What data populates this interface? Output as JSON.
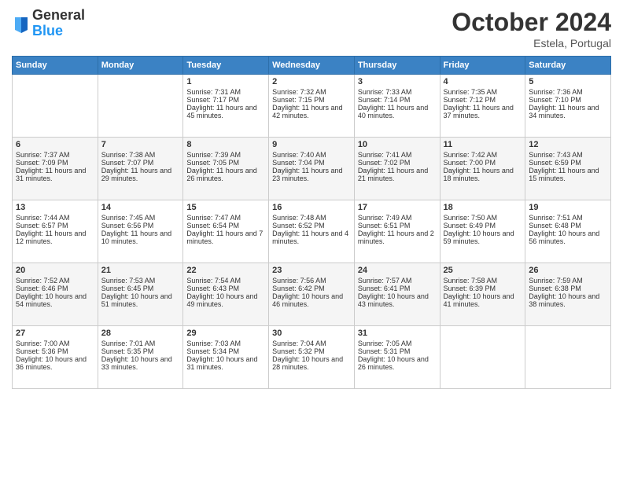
{
  "header": {
    "logo_general": "General",
    "logo_blue": "Blue",
    "month": "October 2024",
    "location": "Estela, Portugal"
  },
  "days_of_week": [
    "Sunday",
    "Monday",
    "Tuesday",
    "Wednesday",
    "Thursday",
    "Friday",
    "Saturday"
  ],
  "weeks": [
    [
      {
        "day": "",
        "content": ""
      },
      {
        "day": "",
        "content": ""
      },
      {
        "day": "1",
        "sunrise": "Sunrise: 7:31 AM",
        "sunset": "Sunset: 7:17 PM",
        "daylight": "Daylight: 11 hours and 45 minutes."
      },
      {
        "day": "2",
        "sunrise": "Sunrise: 7:32 AM",
        "sunset": "Sunset: 7:15 PM",
        "daylight": "Daylight: 11 hours and 42 minutes."
      },
      {
        "day": "3",
        "sunrise": "Sunrise: 7:33 AM",
        "sunset": "Sunset: 7:14 PM",
        "daylight": "Daylight: 11 hours and 40 minutes."
      },
      {
        "day": "4",
        "sunrise": "Sunrise: 7:35 AM",
        "sunset": "Sunset: 7:12 PM",
        "daylight": "Daylight: 11 hours and 37 minutes."
      },
      {
        "day": "5",
        "sunrise": "Sunrise: 7:36 AM",
        "sunset": "Sunset: 7:10 PM",
        "daylight": "Daylight: 11 hours and 34 minutes."
      }
    ],
    [
      {
        "day": "6",
        "sunrise": "Sunrise: 7:37 AM",
        "sunset": "Sunset: 7:09 PM",
        "daylight": "Daylight: 11 hours and 31 minutes."
      },
      {
        "day": "7",
        "sunrise": "Sunrise: 7:38 AM",
        "sunset": "Sunset: 7:07 PM",
        "daylight": "Daylight: 11 hours and 29 minutes."
      },
      {
        "day": "8",
        "sunrise": "Sunrise: 7:39 AM",
        "sunset": "Sunset: 7:05 PM",
        "daylight": "Daylight: 11 hours and 26 minutes."
      },
      {
        "day": "9",
        "sunrise": "Sunrise: 7:40 AM",
        "sunset": "Sunset: 7:04 PM",
        "daylight": "Daylight: 11 hours and 23 minutes."
      },
      {
        "day": "10",
        "sunrise": "Sunrise: 7:41 AM",
        "sunset": "Sunset: 7:02 PM",
        "daylight": "Daylight: 11 hours and 21 minutes."
      },
      {
        "day": "11",
        "sunrise": "Sunrise: 7:42 AM",
        "sunset": "Sunset: 7:00 PM",
        "daylight": "Daylight: 11 hours and 18 minutes."
      },
      {
        "day": "12",
        "sunrise": "Sunrise: 7:43 AM",
        "sunset": "Sunset: 6:59 PM",
        "daylight": "Daylight: 11 hours and 15 minutes."
      }
    ],
    [
      {
        "day": "13",
        "sunrise": "Sunrise: 7:44 AM",
        "sunset": "Sunset: 6:57 PM",
        "daylight": "Daylight: 11 hours and 12 minutes."
      },
      {
        "day": "14",
        "sunrise": "Sunrise: 7:45 AM",
        "sunset": "Sunset: 6:56 PM",
        "daylight": "Daylight: 11 hours and 10 minutes."
      },
      {
        "day": "15",
        "sunrise": "Sunrise: 7:47 AM",
        "sunset": "Sunset: 6:54 PM",
        "daylight": "Daylight: 11 hours and 7 minutes."
      },
      {
        "day": "16",
        "sunrise": "Sunrise: 7:48 AM",
        "sunset": "Sunset: 6:52 PM",
        "daylight": "Daylight: 11 hours and 4 minutes."
      },
      {
        "day": "17",
        "sunrise": "Sunrise: 7:49 AM",
        "sunset": "Sunset: 6:51 PM",
        "daylight": "Daylight: 11 hours and 2 minutes."
      },
      {
        "day": "18",
        "sunrise": "Sunrise: 7:50 AM",
        "sunset": "Sunset: 6:49 PM",
        "daylight": "Daylight: 10 hours and 59 minutes."
      },
      {
        "day": "19",
        "sunrise": "Sunrise: 7:51 AM",
        "sunset": "Sunset: 6:48 PM",
        "daylight": "Daylight: 10 hours and 56 minutes."
      }
    ],
    [
      {
        "day": "20",
        "sunrise": "Sunrise: 7:52 AM",
        "sunset": "Sunset: 6:46 PM",
        "daylight": "Daylight: 10 hours and 54 minutes."
      },
      {
        "day": "21",
        "sunrise": "Sunrise: 7:53 AM",
        "sunset": "Sunset: 6:45 PM",
        "daylight": "Daylight: 10 hours and 51 minutes."
      },
      {
        "day": "22",
        "sunrise": "Sunrise: 7:54 AM",
        "sunset": "Sunset: 6:43 PM",
        "daylight": "Daylight: 10 hours and 49 minutes."
      },
      {
        "day": "23",
        "sunrise": "Sunrise: 7:56 AM",
        "sunset": "Sunset: 6:42 PM",
        "daylight": "Daylight: 10 hours and 46 minutes."
      },
      {
        "day": "24",
        "sunrise": "Sunrise: 7:57 AM",
        "sunset": "Sunset: 6:41 PM",
        "daylight": "Daylight: 10 hours and 43 minutes."
      },
      {
        "day": "25",
        "sunrise": "Sunrise: 7:58 AM",
        "sunset": "Sunset: 6:39 PM",
        "daylight": "Daylight: 10 hours and 41 minutes."
      },
      {
        "day": "26",
        "sunrise": "Sunrise: 7:59 AM",
        "sunset": "Sunset: 6:38 PM",
        "daylight": "Daylight: 10 hours and 38 minutes."
      }
    ],
    [
      {
        "day": "27",
        "sunrise": "Sunrise: 7:00 AM",
        "sunset": "Sunset: 5:36 PM",
        "daylight": "Daylight: 10 hours and 36 minutes."
      },
      {
        "day": "28",
        "sunrise": "Sunrise: 7:01 AM",
        "sunset": "Sunset: 5:35 PM",
        "daylight": "Daylight: 10 hours and 33 minutes."
      },
      {
        "day": "29",
        "sunrise": "Sunrise: 7:03 AM",
        "sunset": "Sunset: 5:34 PM",
        "daylight": "Daylight: 10 hours and 31 minutes."
      },
      {
        "day": "30",
        "sunrise": "Sunrise: 7:04 AM",
        "sunset": "Sunset: 5:32 PM",
        "daylight": "Daylight: 10 hours and 28 minutes."
      },
      {
        "day": "31",
        "sunrise": "Sunrise: 7:05 AM",
        "sunset": "Sunset: 5:31 PM",
        "daylight": "Daylight: 10 hours and 26 minutes."
      },
      {
        "day": "",
        "content": ""
      },
      {
        "day": "",
        "content": ""
      }
    ]
  ]
}
